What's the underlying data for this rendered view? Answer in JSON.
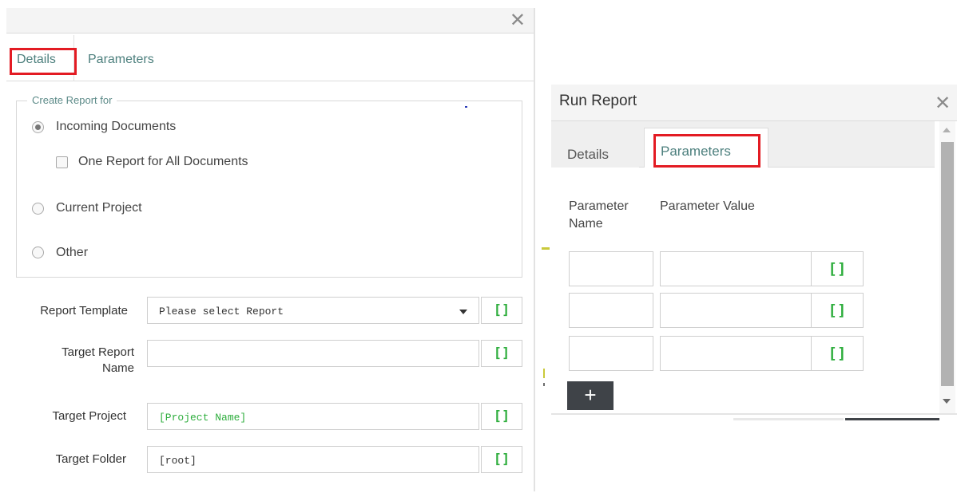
{
  "left_dialog": {
    "tabs": {
      "details": "Details",
      "parameters": "Parameters"
    },
    "fieldset": {
      "legend": "Create Report for",
      "options": {
        "incoming": "Incoming Documents",
        "one_report": "One Report for All Documents",
        "current_project": "Current Project",
        "other": "Other"
      },
      "selected": "Incoming Documents"
    },
    "rows": {
      "report_template": {
        "label": "Report Template",
        "value": "Please select Report",
        "bracket": "[]"
      },
      "target_report_name": {
        "label_line1": "Target Report",
        "label_line2": "Name",
        "value": "",
        "bracket": "[]"
      },
      "target_project": {
        "label": "Target Project",
        "value": "[Project Name]",
        "bracket": "[]"
      },
      "target_folder": {
        "label": "Target Folder",
        "value": "[root]",
        "bracket": "[]"
      }
    }
  },
  "right_dialog": {
    "title": "Run Report",
    "tabs": {
      "details": "Details",
      "parameters": "Parameters"
    },
    "columns": {
      "name_line1": "Parameter",
      "name_line2": "Name",
      "value": "Parameter Value"
    },
    "rows": [
      {
        "name": "",
        "value": "",
        "bracket": "[]"
      },
      {
        "name": "",
        "value": "",
        "bracket": "[]"
      },
      {
        "name": "",
        "value": "",
        "bracket": "[]"
      }
    ],
    "add_button": "+"
  },
  "icons": {
    "close": "close-icon",
    "dropdown": "chevron-down-icon",
    "scroll_up": "scroll-up-icon",
    "scroll_down": "scroll-down-icon"
  },
  "colors": {
    "highlight": "#e31b23",
    "tab_text": "#4c7f7d",
    "variable_green": "#2fae3e",
    "add_button_bg": "#3f4348"
  }
}
